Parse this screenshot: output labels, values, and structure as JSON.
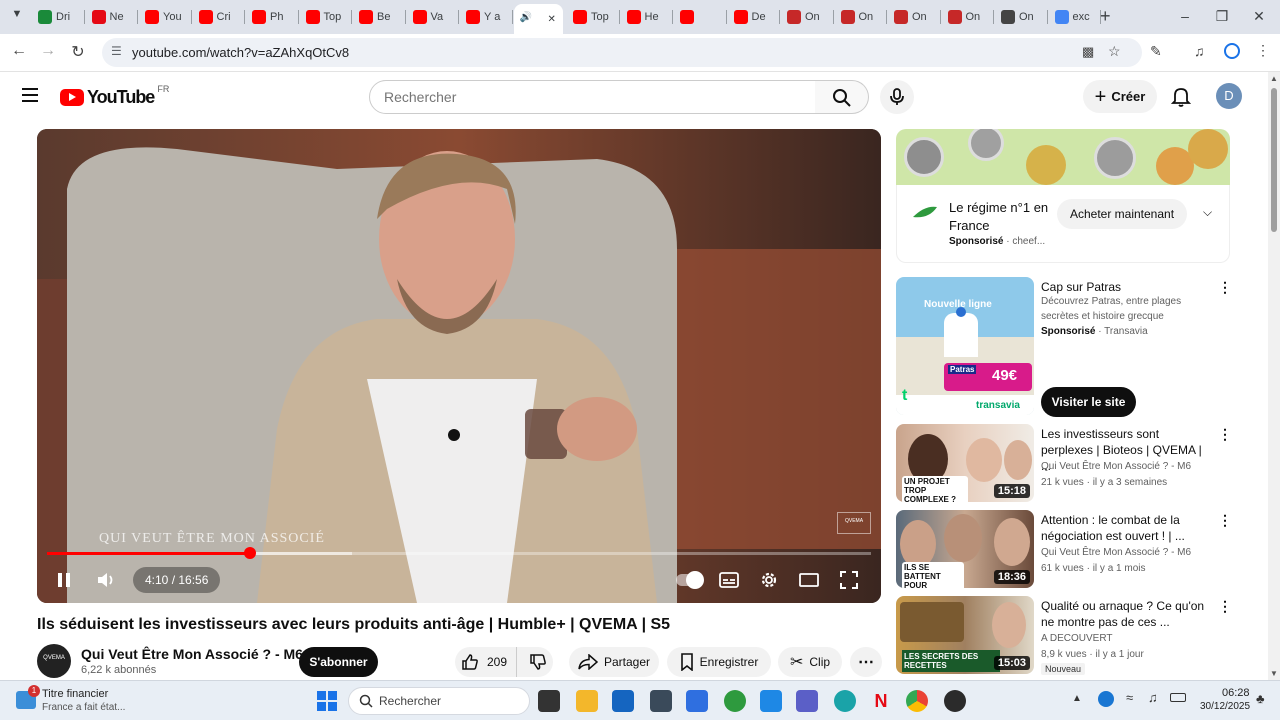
{
  "browser": {
    "tabs": [
      {
        "label": "Dri",
        "color": "#1a8a3a"
      },
      {
        "label": "Ne",
        "color": "#e50914"
      },
      {
        "label": "You",
        "color": "#ff0000"
      },
      {
        "label": "Cri",
        "color": "#ff0000"
      },
      {
        "label": "Ph",
        "color": "#ff0000"
      },
      {
        "label": "Top",
        "color": "#ff0000"
      },
      {
        "label": "Be",
        "color": "#ff0000"
      },
      {
        "label": "Va",
        "color": "#ff0000"
      },
      {
        "label": "Y a",
        "color": "#ff0000"
      },
      {
        "label": "",
        "color": "#ff0000",
        "active": true
      },
      {
        "label": "Top",
        "color": "#ff0000"
      },
      {
        "label": "He",
        "color": "#ff0000"
      },
      {
        "label": "",
        "color": "#ff0000"
      },
      {
        "label": "De",
        "color": "#ff0000"
      },
      {
        "label": "On",
        "color": "#c62828"
      },
      {
        "label": "On",
        "color": "#c62828"
      },
      {
        "label": "On",
        "color": "#c62828"
      },
      {
        "label": "On",
        "color": "#c62828"
      },
      {
        "label": "On",
        "color": "#444444"
      },
      {
        "label": "exc",
        "color": "#4285f4"
      }
    ],
    "url": "youtube.com/watch?v=aZAhXqOtCv8"
  },
  "header": {
    "logo_text": "YouTube",
    "country": "FR",
    "search_placeholder": "Rechercher",
    "create_label": "Créer",
    "avatar_letter": "D"
  },
  "player": {
    "time_current": "4:10",
    "time_total": "16:56",
    "time_display": "4:10 / 16:56",
    "progress_fraction": 0.246,
    "buffered_fraction": 0.37,
    "watermark": "QUI VEUT ÊTRE MON ASSOCIÉ"
  },
  "video": {
    "title": "Ils séduisent les investisseurs avec leurs produits anti-âge | Humble+ | QVEMA | S5",
    "channel": "Qui Veut Être Mon Associé ? - M6",
    "subscribers": "6,22 k abonnés",
    "subscribe_label": "S'abonner",
    "likes": "209",
    "share_label": "Partager",
    "save_label": "Enregistrer",
    "clip_label": "Clip"
  },
  "sidebar": {
    "ad": {
      "title": "Le régime n°1 en France",
      "sponsored": "Sponsorisé",
      "advertiser": "· cheef...",
      "cta": "Acheter maintenant"
    },
    "promo": {
      "title": "Cap sur Patras",
      "description": "Découvrez Patras, entre plages secrètes et histoire grecque",
      "sponsored": "Sponsorisé",
      "advertiser": "· Transavia",
      "cta": "Visiter le site",
      "thumb_headline": "Nouvelle ligne",
      "thumb_price": "49€",
      "thumb_brand": "transavia",
      "thumb_city": "Patras"
    },
    "videos": [
      {
        "title": "Les investisseurs sont perplexes | Bioteos | QVEMA | ...",
        "channel": "Qui Veut Être Mon Associé ? - M6",
        "meta": "21 k vues · il y a 3 semaines",
        "duration": "15:18",
        "caption": "UN PROJET TROP COMPLEXE ?",
        "badge": ""
      },
      {
        "title": "Attention : le combat de la négociation est ouvert ! | ...",
        "channel": "Qui Veut Être Mon Associé ? - M6",
        "meta": "61 k vues · il y a 1 mois",
        "duration": "18:36",
        "caption": "ILS SE BATTENT POUR INVESTIR!",
        "badge": ""
      },
      {
        "title": "Qualité ou arnaque ? Ce qu'on ne montre pas de ces ...",
        "channel": "A DECOUVERT",
        "meta": "8,9 k vues · il y a 1 jour",
        "duration": "15:03",
        "caption": "LES SECRETS DES RECETTES",
        "badge": "Nouveau"
      }
    ]
  },
  "taskbar": {
    "news_title": "Titre financier",
    "news_sub": "France a fait état...",
    "news_badge": "1",
    "search_placeholder": "Rechercher",
    "time": "06:28",
    "date": "30/12/2025"
  }
}
